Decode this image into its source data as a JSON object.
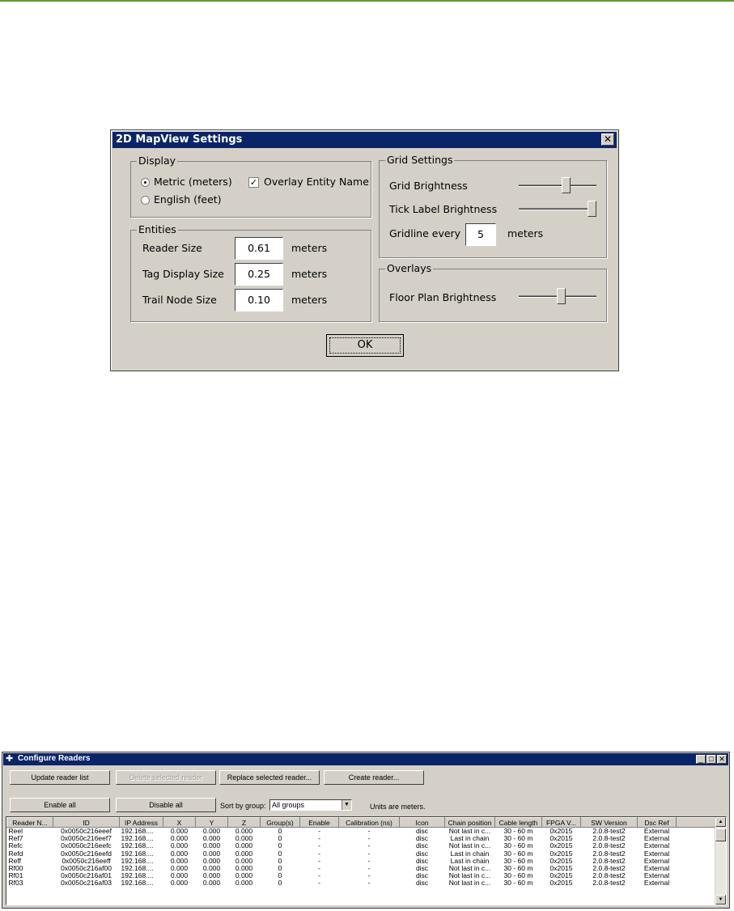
{
  "settings_dialog": {
    "title": "2D MapView Settings",
    "close_glyph": "✕",
    "display": {
      "legend": "Display",
      "metric_label": "Metric (meters)",
      "english_label": "English (feet)",
      "selected": "metric",
      "overlay_entity_label": "Overlay Entity Name",
      "overlay_entity_checked": true
    },
    "entities": {
      "legend": "Entities",
      "rows": [
        {
          "label": "Reader Size",
          "value": "0.61",
          "unit": "meters"
        },
        {
          "label": "Tag Display Size",
          "value": "0.25",
          "unit": "meters"
        },
        {
          "label": "Trail Node Size",
          "value": "0.10",
          "unit": "meters"
        }
      ]
    },
    "grid_settings": {
      "legend": "Grid Settings",
      "grid_brightness_label": "Grid Brightness",
      "grid_brightness_level": 0.62,
      "tick_label_brightness_label": "Tick Label Brightness",
      "tick_label_brightness_level": 1.0,
      "gridline_label": "Gridline every",
      "gridline_value": "5",
      "gridline_unit": "meters"
    },
    "overlays": {
      "legend": "Overlays",
      "floor_plan_label": "Floor Plan Brightness",
      "floor_plan_level": 0.55
    },
    "ok_label": "OK"
  },
  "configure_readers": {
    "title": "Configure Readers",
    "buttons": {
      "update": "Update reader list",
      "delete": "Delete selected reader",
      "replace": "Replace selected reader...",
      "create": "Create reader...",
      "enable_all": "Enable all",
      "disable_all": "Disable all"
    },
    "sort_label": "Sort by group:",
    "sort_value": "All groups",
    "units_note": "Units are meters.",
    "columns": [
      "Reader N...",
      "ID",
      "IP Address",
      "X",
      "Y",
      "Z",
      "Group(s)",
      "Enable",
      "Calibration (ns)",
      "Icon",
      "Chain position",
      "Cable length",
      "FPGA V...",
      "SW Version",
      "Dsc Ref"
    ],
    "rows": [
      [
        "Reel",
        "0x0050c216eeef",
        "192.168....",
        "0.000",
        "0.000",
        "0.000",
        "0",
        "-",
        "-",
        "disc",
        "Not last in c...",
        "30 - 60 m",
        "0x2015",
        "2.0.8-test2",
        "External"
      ],
      [
        "Ref7",
        "0x0050c216eef7",
        "192.168....",
        "0.000",
        "0.000",
        "0.000",
        "0",
        "-",
        "-",
        "disc",
        "Last in chain",
        "30 - 60 m",
        "0x2015",
        "2.0.8-test2",
        "External"
      ],
      [
        "Refc",
        "0x0050c216eefc",
        "192.168....",
        "0.000",
        "0.000",
        "0.000",
        "0",
        "-",
        "-",
        "disc",
        "Not last in c...",
        "30 - 60 m",
        "0x2015",
        "2.0.8-test2",
        "External"
      ],
      [
        "Refd",
        "0x0050c216eefd",
        "192.168....",
        "0.000",
        "0.000",
        "0.000",
        "0",
        "-",
        "-",
        "disc",
        "Last in chain",
        "30 - 60 m",
        "0x2015",
        "2.0.8-test2",
        "External"
      ],
      [
        "Reff",
        "0x0050c216eeff",
        "192.168....",
        "0.000",
        "0.000",
        "0.000",
        "0",
        "-",
        "-",
        "disc",
        "Last in chain",
        "30 - 60 m",
        "0x2015",
        "2.0.8-test2",
        "External"
      ],
      [
        "Rf00",
        "0x0050c216af00",
        "192.168....",
        "0.000",
        "0.000",
        "0.000",
        "0",
        "-",
        "-",
        "disc",
        "Not last in c...",
        "30 - 60 m",
        "0x2015",
        "2.0.8-test2",
        "External"
      ],
      [
        "Rf01",
        "0x0050c216af01",
        "192.168....",
        "0.000",
        "0.000",
        "0.000",
        "0",
        "-",
        "-",
        "disc",
        "Not last in c...",
        "30 - 60 m",
        "0x2015",
        "2.0.8-test2",
        "External"
      ],
      [
        "Rf03",
        "0x0050c216af03",
        "192.168....",
        "0.000",
        "0.000",
        "0.000",
        "0",
        "-",
        "-",
        "disc",
        "Not last in c...",
        "30 - 60 m",
        "0x2015",
        "2.0.8-test2",
        "External"
      ]
    ]
  }
}
